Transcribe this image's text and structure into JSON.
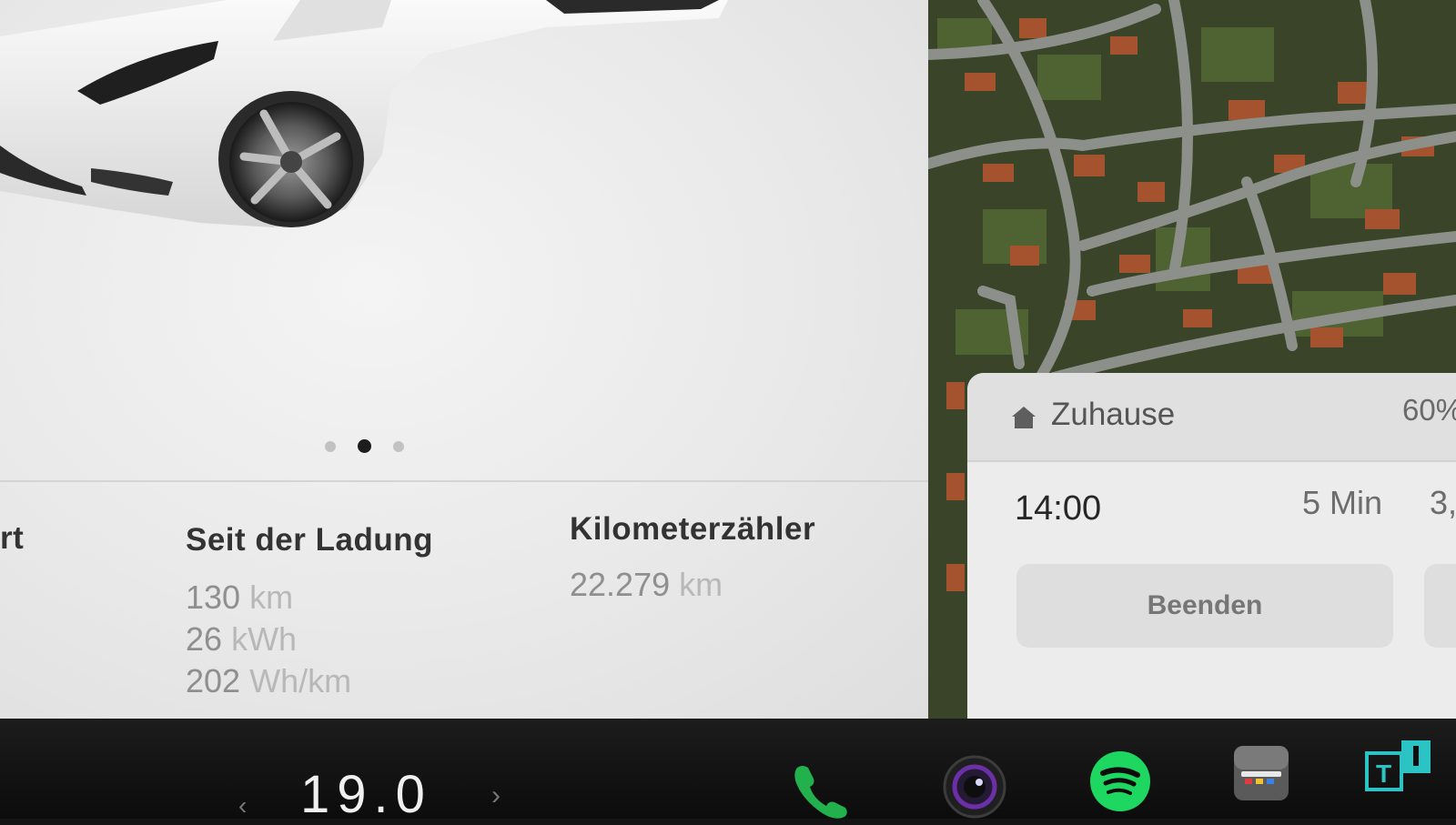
{
  "vehicle": {
    "pager": {
      "pages": 3,
      "active": 2
    },
    "stats": {
      "partial_header": "rt",
      "since_charge": {
        "title": "Seit der Ladung",
        "distance": {
          "value": "130",
          "unit": "km"
        },
        "energy": {
          "value": "26",
          "unit": "kWh"
        },
        "consumption": {
          "value": "202",
          "unit": "Wh/km"
        }
      },
      "odometer": {
        "title": "Kilometerzähler",
        "value": "22.279",
        "unit": "km"
      }
    }
  },
  "navigation": {
    "destination": "Zuhause",
    "battery_at_arrival": "60%",
    "arrival_time": "14:00",
    "duration": "5 Min",
    "distance": "3,",
    "end_label": "Beenden"
  },
  "taskbar": {
    "temperature": "19.0",
    "icons": [
      "phone-icon",
      "camera-icon",
      "spotify-icon",
      "toybox-icon",
      "tesla-app-icon"
    ]
  },
  "colors": {
    "spotify_green": "#1ED760",
    "phone_green": "#22B14C",
    "teal_app": "#2BC3C3",
    "camera_purple": "#6B2FA8"
  }
}
